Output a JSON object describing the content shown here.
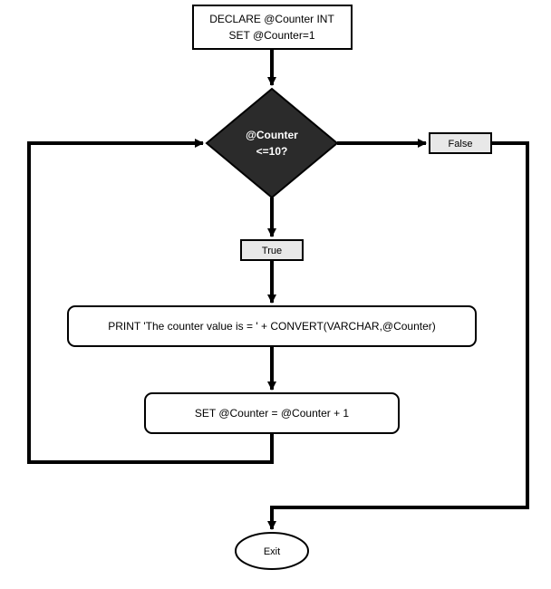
{
  "chart_data": {
    "type": "flowchart",
    "nodes": [
      {
        "id": "declare",
        "kind": "process",
        "lines": [
          "DECLARE @Counter INT",
          "SET @Counter=1"
        ]
      },
      {
        "id": "decision",
        "kind": "decision",
        "lines": [
          "@Counter",
          "<=10?"
        ]
      },
      {
        "id": "false",
        "kind": "label",
        "text": "False"
      },
      {
        "id": "true",
        "kind": "label",
        "text": "True"
      },
      {
        "id": "print",
        "kind": "process",
        "text": "PRINT 'The counter value is = ' + CONVERT(VARCHAR,@Counter)"
      },
      {
        "id": "increment",
        "kind": "process",
        "text": "SET @Counter = @Counter + 1"
      },
      {
        "id": "exit",
        "kind": "terminator",
        "text": "Exit"
      }
    ],
    "edges": [
      {
        "from": "declare",
        "to": "decision"
      },
      {
        "from": "decision",
        "to": "false",
        "label": "false-branch"
      },
      {
        "from": "decision",
        "to": "true",
        "label": "true-branch"
      },
      {
        "from": "true",
        "to": "print"
      },
      {
        "from": "print",
        "to": "increment"
      },
      {
        "from": "increment",
        "to": "decision",
        "label": "loop-back"
      },
      {
        "from": "false",
        "to": "exit",
        "label": "exit-path"
      }
    ]
  },
  "declare": {
    "line1": "DECLARE @Counter INT",
    "line2": "SET @Counter=1"
  },
  "decision": {
    "line1": "@Counter",
    "line2": "<=10?"
  },
  "false_label": "False",
  "true_label": "True",
  "print_text": "PRINT 'The counter value is = ' + CONVERT(VARCHAR,@Counter)",
  "increment_text": "SET @Counter = @Counter + 1",
  "exit_text": "Exit"
}
